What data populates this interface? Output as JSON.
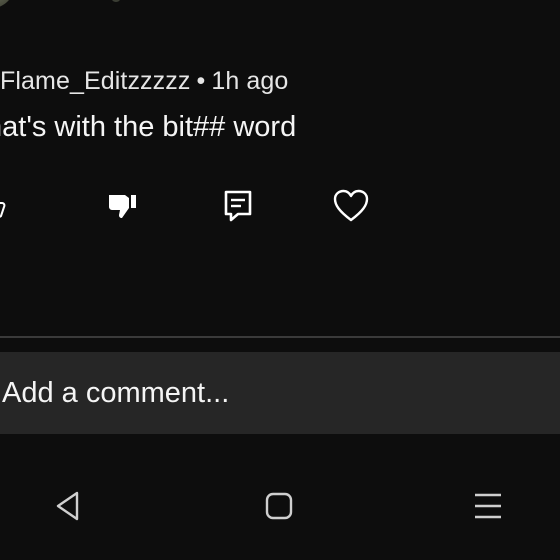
{
  "comment": {
    "author": "Flame_Editzzzzz",
    "separator": "•",
    "time": "1h ago",
    "text": "hat's with the bit## word"
  },
  "actions": {
    "like_icon": "thumbs-up-icon",
    "dislike_icon": "thumbs-down-filled-icon",
    "reply_icon": "reply-comment-icon",
    "heart_icon": "heart-outline-icon"
  },
  "composer": {
    "placeholder": "Add a comment..."
  },
  "navigation": {
    "back_icon": "back-triangle-icon",
    "home_icon": "home-square-icon",
    "menu_icon": "menu-lines-icon"
  },
  "colors": {
    "background": "#0d0d0d",
    "composer_background": "#262626",
    "divider": "#3a3a3a",
    "text": "#f1f1f1",
    "icon": "#ffffff"
  }
}
